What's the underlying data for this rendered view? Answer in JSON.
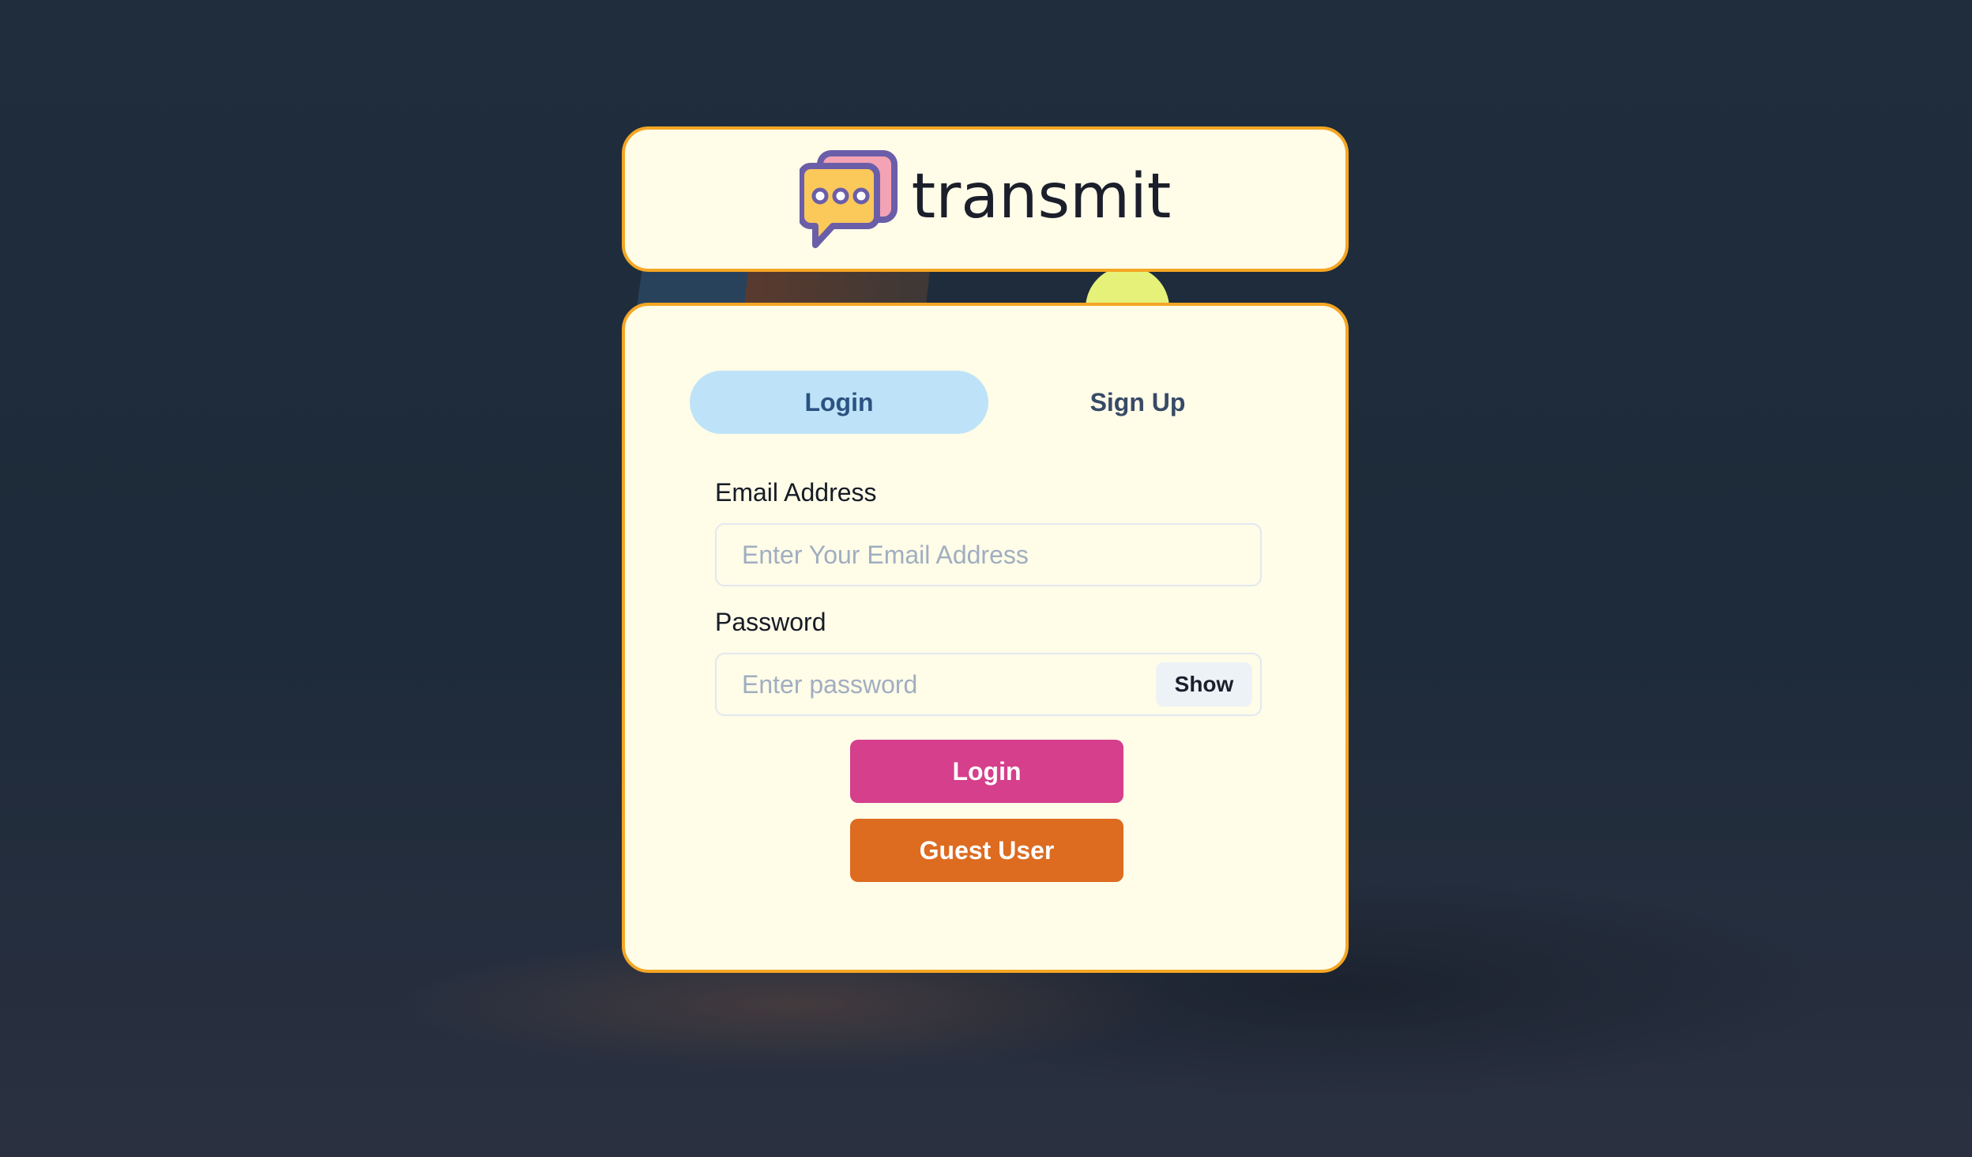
{
  "brand": {
    "name": "transmit",
    "logo_icon": "chat-bubbles-icon"
  },
  "tabs": [
    {
      "label": "Login",
      "active": true
    },
    {
      "label": "Sign Up",
      "active": false
    }
  ],
  "form": {
    "email": {
      "label": "Email Address",
      "placeholder": "Enter Your Email Address",
      "value": ""
    },
    "password": {
      "label": "Password",
      "placeholder": "Enter password",
      "value": "",
      "toggle_label": "Show"
    },
    "submit_label": "Login",
    "guest_label": "Guest User"
  },
  "colors": {
    "card_background": "#fffce8",
    "card_border": "#f5a623",
    "tab_active": "#bee3f8",
    "login_button": "#d53f8c",
    "guest_button": "#dd6b20",
    "page_background": "#1f2d3c"
  }
}
